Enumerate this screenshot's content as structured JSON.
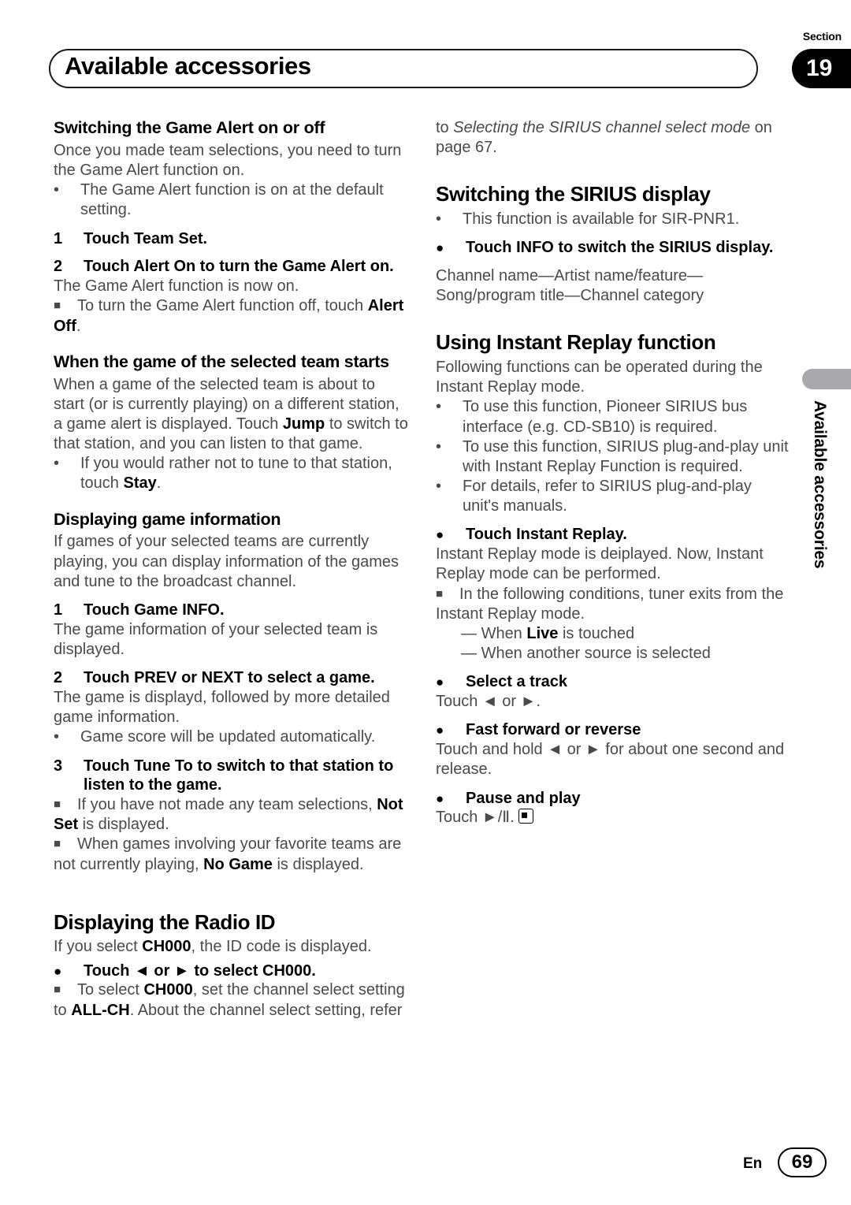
{
  "header": {
    "title": "Available accessories",
    "section_label": "Section",
    "section_number": "19"
  },
  "side_tab": {
    "label": "Available accessories"
  },
  "footer": {
    "language": "En",
    "page_number": "69"
  },
  "markers": {
    "dot": "•",
    "square": "■",
    "filled_circle": "●",
    "em_dash": "—"
  },
  "left_column": {
    "s1": {
      "heading": "Switching the Game Alert on or off",
      "intro": "Once you made team selections, you need to turn the Game Alert function on.",
      "note1": "The Game Alert function is on at the default setting.",
      "step1_num": "1",
      "step1_text": "Touch Team Set.",
      "step2_num": "2",
      "step2_text": "Touch Alert On to turn the Game Alert on.",
      "step2_result": "The Game Alert function is now on.",
      "note2_pre": "To turn the Game Alert function off, touch ",
      "note2_bold": "Alert Off",
      "note2_post": "."
    },
    "s2": {
      "heading": "When the game of the selected team starts",
      "p1_a": "When a game of the selected team is about to start (or is currently playing) on a different station, a game alert is displayed. Touch ",
      "p1_bold": "Jump",
      "p1_b": " to switch to that station, and you can listen to that game.",
      "note1_a": "If you would rather not to tune to that station, touch ",
      "note1_bold": "Stay",
      "note1_b": "."
    },
    "s3": {
      "heading": "Displaying game information",
      "intro": "If games of your selected teams are currently playing, you can display information of the games and tune to the broadcast channel.",
      "step1_num": "1",
      "step1_text": "Touch Game INFO.",
      "step1_result": "The game information of your selected team is displayed.",
      "step2_num": "2",
      "step2_text": "Touch PREV or NEXT to select a game.",
      "step2_result": "The game is displayd, followed by more detailed game information.",
      "note1": "Game score will be updated automatically.",
      "step3_num": "3",
      "step3_text": "Touch Tune To to switch to that station to listen to the game.",
      "note2_a": "If you have not made any team selections, ",
      "note2_bold": "Not Set",
      "note2_b": " is displayed.",
      "note3_a": "When games involving your favorite teams are not currently playing, ",
      "note3_bold": "No Game",
      "note3_b": " is displayed."
    },
    "s4": {
      "heading": "Displaying the Radio ID",
      "intro_a": "If you select ",
      "intro_bold": "CH000",
      "intro_b": ", the ID code is displayed.",
      "op_text": "Touch ◄ or ► to select CH000.",
      "note_a": "To select ",
      "note_bold1": "CH000",
      "note_b": ", set the channel select setting to ",
      "note_bold2": "ALL-CH",
      "note_c": ". About the channel select setting, refer"
    }
  },
  "right_column": {
    "cont": {
      "a": "to ",
      "italic": "Selecting the SIRIUS channel select mode",
      "b": " on page 67."
    },
    "s5": {
      "heading": "Switching the SIRIUS display",
      "note1": "This function is available for SIR-PNR1.",
      "op_text": "Touch INFO to switch the SIRIUS display.",
      "result": "Channel name—Artist name/feature—Song/program title—Channel category"
    },
    "s6": {
      "heading": "Using Instant Replay function",
      "intro": "Following functions can be operated during the Instant Replay mode.",
      "note1": "To use this function, Pioneer SIRIUS bus interface (e.g. CD-SB10) is required.",
      "note2": "To use this function, SIRIUS plug-and-play unit with Instant Replay Function is required.",
      "note3": "For details, refer to SIRIUS plug-and-play unit's manuals.",
      "op1_text": "Touch Instant Replay.",
      "op1_result": "Instant Replay mode is deiplayed. Now, Instant Replay mode can be performed.",
      "note4": "In the following conditions, tuner exits from the Instant Replay mode.",
      "sub1_a": "When ",
      "sub1_bold": "Live",
      "sub1_b": " is touched",
      "sub2": "When another source is selected",
      "op2_text": "Select a track",
      "op2_result": "Touch ◄ or ►.",
      "op3_text": "Fast forward or reverse",
      "op3_result": "Touch and hold ◄ or ► for about one second and release.",
      "op4_text": "Pause and play",
      "op4_result": "Touch ►/Ⅱ."
    }
  }
}
